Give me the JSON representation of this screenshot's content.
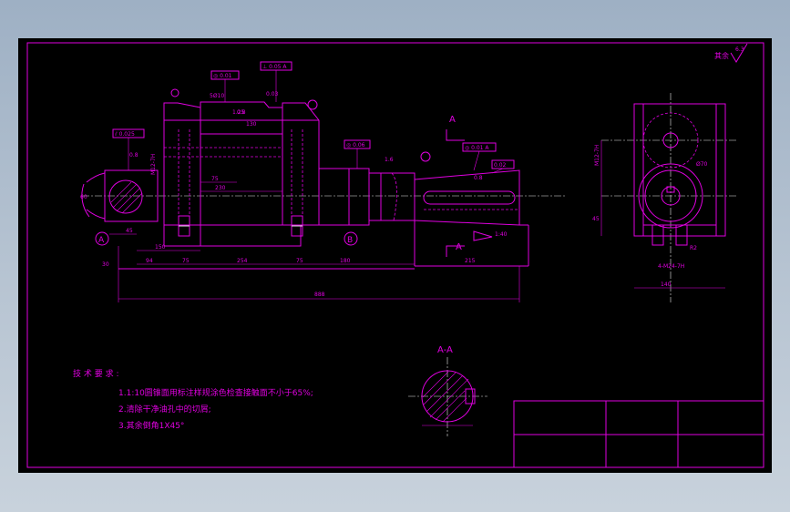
{
  "drawing": {
    "roughness_symbol": "其余",
    "roughness_value": "6.3",
    "section_label": "A",
    "section_title": "A-A",
    "circle_markers": [
      "A",
      "B"
    ]
  },
  "tolerances": [
    "⊥ 0.05 A",
    "◎ 0.01",
    "0.03",
    "⫽ 0.025",
    "0.8",
    "◎ 0.01 A",
    "0.02",
    "1.6",
    "0.8",
    "◎ 0.06",
    "1.25",
    "◎ 0.01 A",
    "0.02 B"
  ],
  "dimensions": {
    "top_a": "5Ø10",
    "top_b": "0.8",
    "d1": "130",
    "d2": "75",
    "d3": "230",
    "d4": "45",
    "d5": "150",
    "d6": "94",
    "d7": "75",
    "d8": "254",
    "d9": "75",
    "d10": "180",
    "d11": "215",
    "d12": "888",
    "d13": "1:40",
    "d14": "60",
    "d15": "30",
    "d16": "M12-7H",
    "d17": "M12-7H",
    "d18": "4-M24-7H",
    "d19": "140",
    "d20": "Ø70",
    "d21": "R2",
    "d22": "45"
  },
  "notes": {
    "heading": "技 术 要 求 :",
    "items": [
      "1.1:10圆锥面用标注样规涂色检查接触面不小于65%;",
      "2.清除干净油孔中的切屑;",
      "3.其余倒角1X45°"
    ]
  },
  "title_block": {
    "cells": [
      "",
      "",
      "",
      "",
      "",
      ""
    ]
  }
}
